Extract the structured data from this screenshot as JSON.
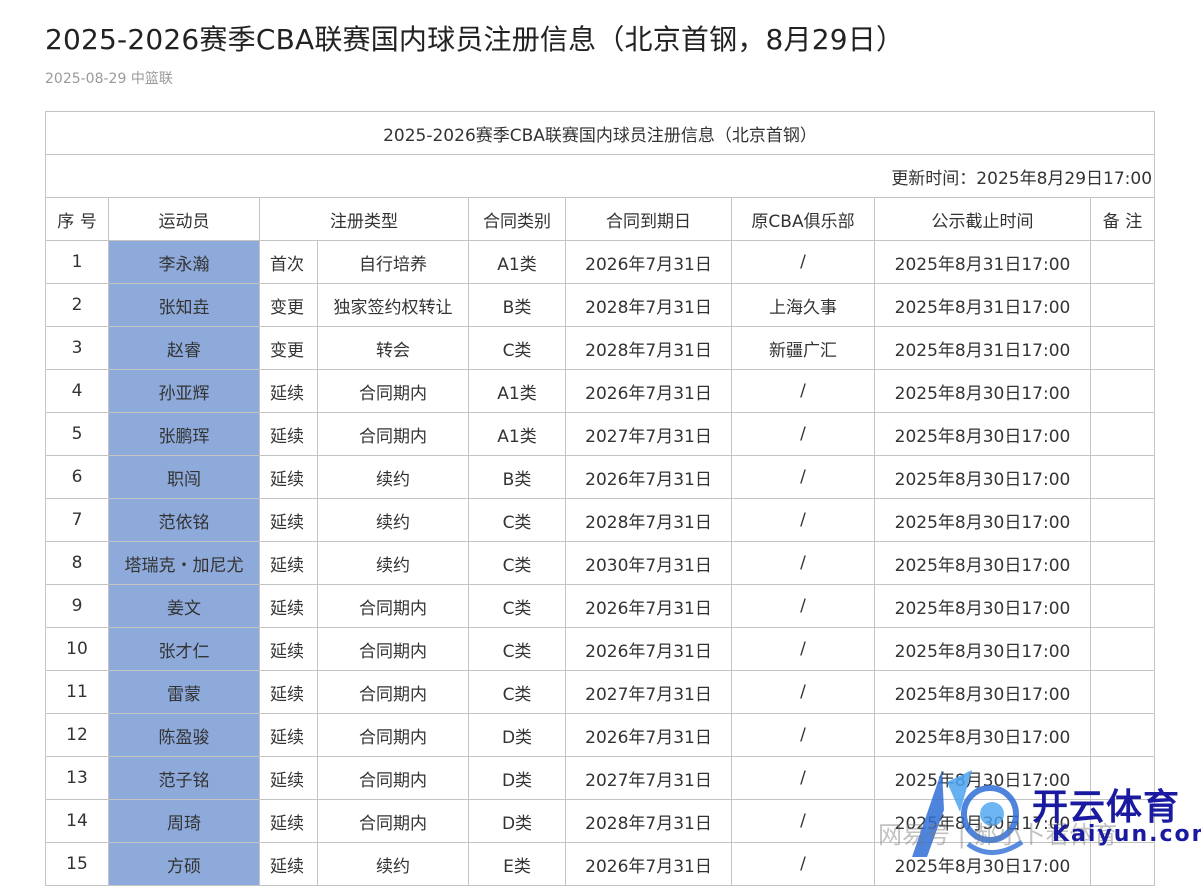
{
  "article": {
    "title": "2025-2026赛季CBA联赛国内球员注册信息（北京首钢，8月29日）",
    "date": "2025-08-29",
    "source": "中篮联"
  },
  "table": {
    "caption": "2025-2026赛季CBA联赛国内球员注册信息（北京首钢）",
    "update_time": "更新时间：2025年8月29日17:00",
    "headers": {
      "no": "序 号",
      "player": "运动员",
      "reg_type": "注册类型",
      "contract_class": "合同类别",
      "expiry": "合同到期日",
      "former_club": "原CBA俱乐部",
      "deadline": "公示截止时间",
      "remark": "备 注"
    },
    "rows": [
      {
        "no": "1",
        "player": "李永瀚",
        "type1": "首次",
        "type2": "自行培养",
        "cls": "A1类",
        "expiry": "2026年7月31日",
        "club": "/",
        "deadline": "2025年8月31日17:00",
        "remark": ""
      },
      {
        "no": "2",
        "player": "张知垚",
        "type1": "变更",
        "type2": "独家签约权转让",
        "cls": "B类",
        "expiry": "2028年7月31日",
        "club": "上海久事",
        "deadline": "2025年8月31日17:00",
        "remark": ""
      },
      {
        "no": "3",
        "player": "赵睿",
        "type1": "变更",
        "type2": "转会",
        "cls": "C类",
        "expiry": "2028年7月31日",
        "club": "新疆广汇",
        "deadline": "2025年8月31日17:00",
        "remark": ""
      },
      {
        "no": "4",
        "player": "孙亚辉",
        "type1": "延续",
        "type2": "合同期内",
        "cls": "A1类",
        "expiry": "2026年7月31日",
        "club": "/",
        "deadline": "2025年8月30日17:00",
        "remark": ""
      },
      {
        "no": "5",
        "player": "张鹏珲",
        "type1": "延续",
        "type2": "合同期内",
        "cls": "A1类",
        "expiry": "2027年7月31日",
        "club": "/",
        "deadline": "2025年8月30日17:00",
        "remark": ""
      },
      {
        "no": "6",
        "player": "职闯",
        "type1": "延续",
        "type2": "续约",
        "cls": "B类",
        "expiry": "2026年7月31日",
        "club": "/",
        "deadline": "2025年8月30日17:00",
        "remark": ""
      },
      {
        "no": "7",
        "player": "范依铭",
        "type1": "延续",
        "type2": "续约",
        "cls": "C类",
        "expiry": "2028年7月31日",
        "club": "/",
        "deadline": "2025年8月30日17:00",
        "remark": ""
      },
      {
        "no": "8",
        "player": "塔瑞克・加尼尤",
        "type1": "延续",
        "type2": "续约",
        "cls": "C类",
        "expiry": "2030年7月31日",
        "club": "/",
        "deadline": "2025年8月30日17:00",
        "remark": ""
      },
      {
        "no": "9",
        "player": "姜文",
        "type1": "延续",
        "type2": "合同期内",
        "cls": "C类",
        "expiry": "2026年7月31日",
        "club": "/",
        "deadline": "2025年8月30日17:00",
        "remark": ""
      },
      {
        "no": "10",
        "player": "张才仁",
        "type1": "延续",
        "type2": "合同期内",
        "cls": "C类",
        "expiry": "2026年7月31日",
        "club": "/",
        "deadline": "2025年8月30日17:00",
        "remark": ""
      },
      {
        "no": "11",
        "player": "雷蒙",
        "type1": "延续",
        "type2": "合同期内",
        "cls": "C类",
        "expiry": "2027年7月31日",
        "club": "/",
        "deadline": "2025年8月30日17:00",
        "remark": ""
      },
      {
        "no": "12",
        "player": "陈盈骏",
        "type1": "延续",
        "type2": "合同期内",
        "cls": "D类",
        "expiry": "2026年7月31日",
        "club": "/",
        "deadline": "2025年8月30日17:00",
        "remark": ""
      },
      {
        "no": "13",
        "player": "范子铭",
        "type1": "延续",
        "type2": "合同期内",
        "cls": "D类",
        "expiry": "2027年7月31日",
        "club": "/",
        "deadline": "2025年8月30日17:00",
        "remark": ""
      },
      {
        "no": "14",
        "player": "周琦",
        "type1": "延续",
        "type2": "合同期内",
        "cls": "D类",
        "expiry": "2028年7月31日",
        "club": "/",
        "deadline": "2025年8月30日17:00",
        "remark": ""
      },
      {
        "no": "15",
        "player": "方硕",
        "type1": "延续",
        "type2": "续约",
        "cls": "E类",
        "expiry": "2026年7月31日",
        "club": "/",
        "deadline": "2025年8月30日17:00",
        "remark": ""
      }
    ]
  },
  "watermark": {
    "brand_cn": "开云体育",
    "brand_en": "Kaiyun.com",
    "faint_text": "网易号 | 郝小卜看体育"
  },
  "colors": {
    "player_cell_bg": "#8eaadb",
    "border": "#c4c4c4",
    "watermark_blue": "#1a1aa0"
  }
}
